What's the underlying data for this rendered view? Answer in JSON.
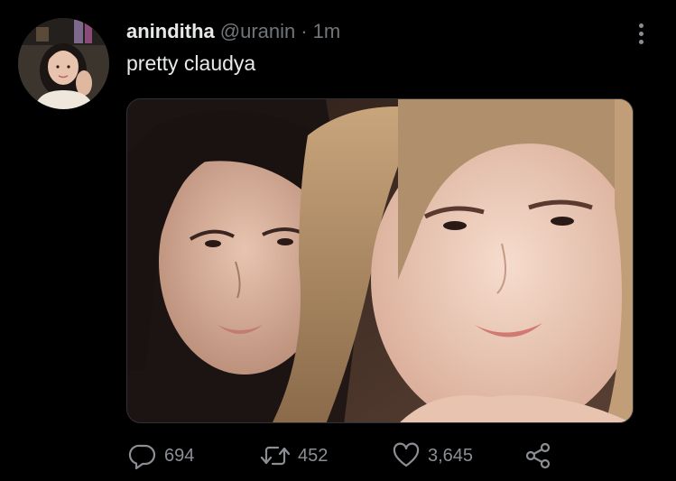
{
  "tweet": {
    "display_name": "aninditha",
    "handle": "@uranin",
    "separator": "·",
    "time": "1m",
    "text": "pretty claudya"
  },
  "avatar": {
    "icon": "profile-photo"
  },
  "media": {
    "icon": "photo-two-people-selfie"
  },
  "actions": {
    "reply_count": "694",
    "retweet_count": "452",
    "like_count": "3,645"
  },
  "colors": {
    "background": "#000000",
    "primary_text": "#e7e9ea",
    "secondary_text": "#71767b",
    "icon": "#8b8f94"
  }
}
